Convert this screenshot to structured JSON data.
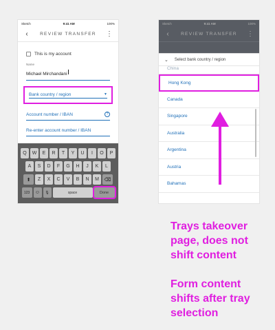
{
  "left_screen": {
    "status": {
      "carrier": "Sketch",
      "time": "9:41 AM",
      "battery": "100%"
    },
    "header": {
      "title": "REVIEW TRANSFER",
      "back": "‹",
      "more": "⋮"
    },
    "checkbox_label": "This is my account",
    "name_label": "Name",
    "name_value": "Michael Mirchandani",
    "country_select": "Bank country / region",
    "account_field": "Account number / IBAN",
    "reenter_field": "Re-enter account number / IBAN",
    "keyboard": {
      "row1": [
        "Q",
        "W",
        "E",
        "R",
        "T",
        "Y",
        "U",
        "I",
        "O",
        "P"
      ],
      "row2": [
        "A",
        "S",
        "D",
        "F",
        "G",
        "H",
        "J",
        "K",
        "L"
      ],
      "row3": [
        "Z",
        "X",
        "C",
        "V",
        "B",
        "N",
        "M"
      ],
      "shift": "⬆",
      "backspace": "⌫",
      "numbers": "123",
      "emoji": "☺",
      "mic": "🎙",
      "space": "space",
      "done": "Done"
    }
  },
  "right_screen": {
    "status": {
      "carrier": "Sketch",
      "time": "9:41 AM",
      "battery": "100%"
    },
    "header": {
      "title": "REVIEW TRANSFER",
      "back": "‹",
      "more": "⋮"
    },
    "tray_title": "Select bank country / region",
    "tray_chevron": "⌄",
    "countries_partial": "China",
    "countries": [
      "Hong Kong",
      "Canada",
      "Singapore",
      "Australia",
      "Argentina",
      "Austria",
      "Bahamas"
    ]
  },
  "annotations": {
    "note1": "Trays takeover page, does not shift content",
    "note2": "Form content shifts after tray selection"
  },
  "colors": {
    "highlight": "#e01ee0",
    "link": "#1f6fb8"
  }
}
